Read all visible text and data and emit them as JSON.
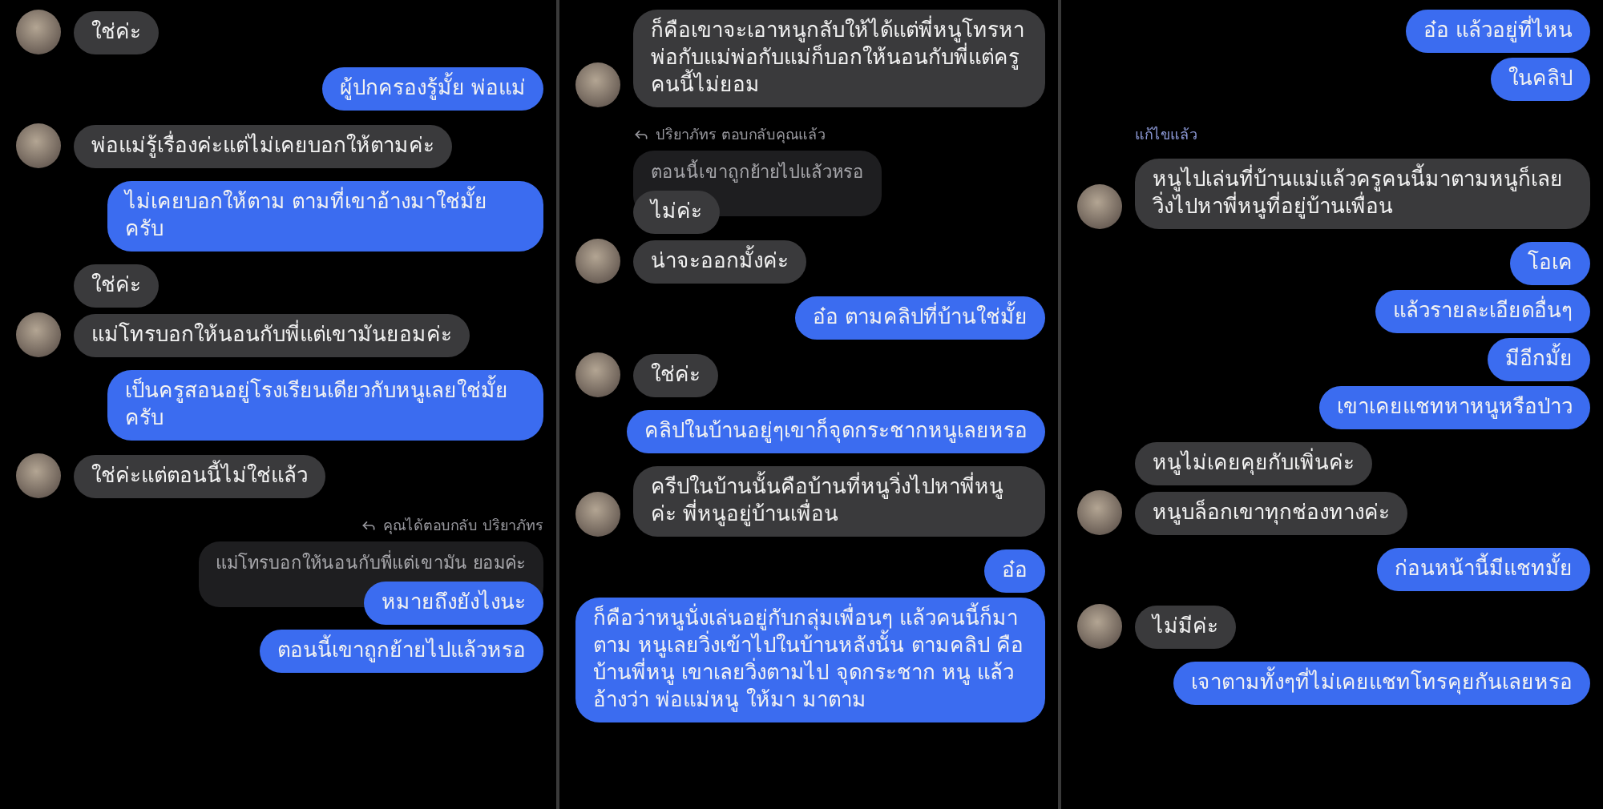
{
  "panels": [
    {
      "messages": [
        {
          "kind": "incoming",
          "text": "ใช่ค่ะ",
          "avatar": true
        },
        {
          "kind": "outgoing",
          "text": "ผู้ปกครองรู้มั้ย พ่อแม่"
        },
        {
          "kind": "incoming",
          "text": "พ่อแม่รู้เรื่องค่ะแต่ไม่เคยบอกให้ตามค่ะ",
          "avatar": true
        },
        {
          "kind": "outgoing",
          "text": "ไม่เคยบอกให้ตาม ตามที่เขาอ้างมาใช่มั้ยครับ"
        },
        {
          "kind": "incoming",
          "text": "ใช่ค่ะ",
          "avatar": false
        },
        {
          "kind": "incoming",
          "text": "แม่โทรบอกให้นอนกับพี่แต่เขามันยอมค่ะ",
          "avatar": true
        },
        {
          "kind": "outgoing",
          "text": "เป็นครูสอนอยู่โรงเรียนเดียวกับหนูเลยใช่มั้ยครับ"
        },
        {
          "kind": "incoming",
          "text": "ใช่ค่ะแต่ตอนนี้ไม่ใช่แล้ว",
          "avatar": true
        },
        {
          "kind": "sent_reply_note",
          "text": "คุณได้ตอบกลับ ปริยาภัทร"
        },
        {
          "kind": "sent_quote",
          "text": "แม่โทรบอกให้นอนกับพี่แต่เขามัน ยอมค่ะ"
        },
        {
          "kind": "outgoing",
          "text": "หมายถึงยังไงนะ"
        },
        {
          "kind": "outgoing",
          "text": "ตอนนี้เขาถูกย้ายไปแล้วหรอ"
        }
      ]
    },
    {
      "messages": [
        {
          "kind": "incoming",
          "text": "ก็คือเขาจะเอาหนูกลับให้ได้แต่พี่หนูโทรหาพ่อกับแม่พ่อกับแม่ก็บอกให้นอนกับพี่แต่ครูคนนี้ไม่ยอม",
          "avatar": true
        },
        {
          "kind": "received_reply_note",
          "text": "ปริยาภัทร ตอบกลับคุณแล้ว"
        },
        {
          "kind": "received_quote",
          "text": "ตอนนี้เขาถูกย้ายไปแล้วหรอ"
        },
        {
          "kind": "incoming",
          "text": "ไม่ค่ะ",
          "avatar": false
        },
        {
          "kind": "incoming",
          "text": "น่าจะออกมั้งค่ะ",
          "avatar": true
        },
        {
          "kind": "outgoing",
          "text": "อ๋อ ตามคลิปที่บ้านใช่มั้ย"
        },
        {
          "kind": "incoming",
          "text": "ใช่ค่ะ",
          "avatar": true
        },
        {
          "kind": "outgoing",
          "text": "คลิปในบ้านอยู่ๆเขาก็จุดกระชากหนูเลยหรอ"
        },
        {
          "kind": "incoming",
          "text": "ครีปในบ้านนั้นคือบ้านที่หนูวิ่งไปหาพี่หนูค่ะ พี่หนูอยู่บ้านเพื่อน",
          "avatar": true
        },
        {
          "kind": "outgoing",
          "text": "อ๋อ"
        },
        {
          "kind": "outgoing",
          "text": "ก็คือว่าหนูนั่งเล่นอยู่กับกลุ่มเพื่อนๆ แล้วคนนี้ก็มาตาม หนูเลยวิ่งเข้าไปในบ้านหลังนั้น ตามคลิป คือบ้านพี่หนู เขาเลยวิ่งตามไป จุดกระชาก หนู แล้วอ้างว่า พ่อแม่หนู ให้มา มาตาม"
        }
      ]
    },
    {
      "messages": [
        {
          "kind": "outgoing",
          "text": "อ๋อ แล้วอยู่ที่ไหน"
        },
        {
          "kind": "outgoing",
          "text": "ในคลิป"
        },
        {
          "kind": "edited_note",
          "text": "แก้ไขแล้ว"
        },
        {
          "kind": "incoming",
          "text": "หนูไปเล่นที่บ้านแม่แล้วครูคนนี้มาตามหนูก็เลยวิ่งไปหาพี่หนูที่อยู่บ้านเพื่อน",
          "avatar": true
        },
        {
          "kind": "outgoing",
          "text": "โอเค"
        },
        {
          "kind": "outgoing",
          "text": "แล้วรายละเอียดอื่นๆ"
        },
        {
          "kind": "outgoing",
          "text": "มีอีกมั้ย"
        },
        {
          "kind": "outgoing",
          "text": "เขาเคยแชทหาหนูหรือป่าว"
        },
        {
          "kind": "incoming",
          "text": "หนูไม่เคยคุยกับเพิ่นค่ะ",
          "avatar": false
        },
        {
          "kind": "incoming",
          "text": "หนูบล็อกเขาทุกช่องทางค่ะ",
          "avatar": true
        },
        {
          "kind": "outgoing",
          "text": "ก่อนหน้านี้มีแชทมั้ย"
        },
        {
          "kind": "incoming",
          "text": "ไม่มีค่ะ",
          "avatar": true
        },
        {
          "kind": "outgoing",
          "text": "เจาตามทั้งๆที่ไม่เคยแชทโทรคุยกันเลยหรอ"
        }
      ]
    }
  ]
}
